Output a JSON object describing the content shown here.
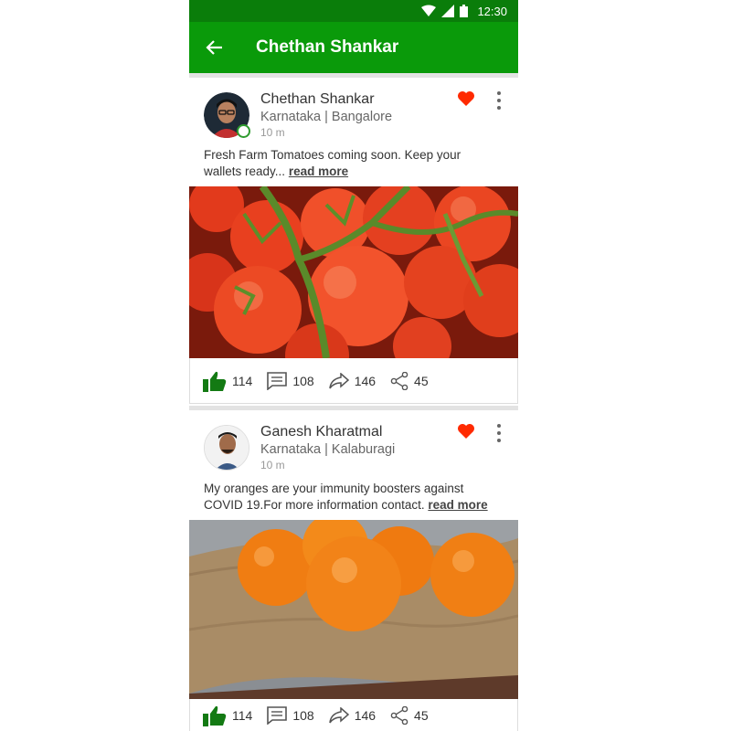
{
  "statusbar": {
    "time": "12:30",
    "icons": [
      "wifi-icon",
      "signal-icon",
      "battery-icon"
    ]
  },
  "appbar": {
    "title": "Chethan Shankar",
    "back_icon": "arrow-back-icon"
  },
  "colors": {
    "appbar": "#0a9a0a",
    "statusbar": "#0a7d0a",
    "heart": "#ff2a00",
    "like": "#137a13"
  },
  "posts": [
    {
      "author": "Chethan Shankar",
      "location": "Karnataka | Bangalore",
      "time": "10 m",
      "text": "Fresh Farm Tomatoes coming soon. Keep your wallets ready...",
      "read_more": "read more",
      "image": "tomatoes-photo",
      "likes": "114",
      "comments": "108",
      "forwards": "146",
      "shares": "45"
    },
    {
      "author": "Ganesh Kharatmal",
      "location": "Karnataka | Kalaburagi",
      "time": "10 m",
      "text": "My oranges are your immunity boosters against COVID 19.For more information contact.",
      "read_more": "read more",
      "image": "oranges-photo",
      "likes": "114",
      "comments": "108",
      "forwards": "146",
      "shares": "45"
    }
  ]
}
